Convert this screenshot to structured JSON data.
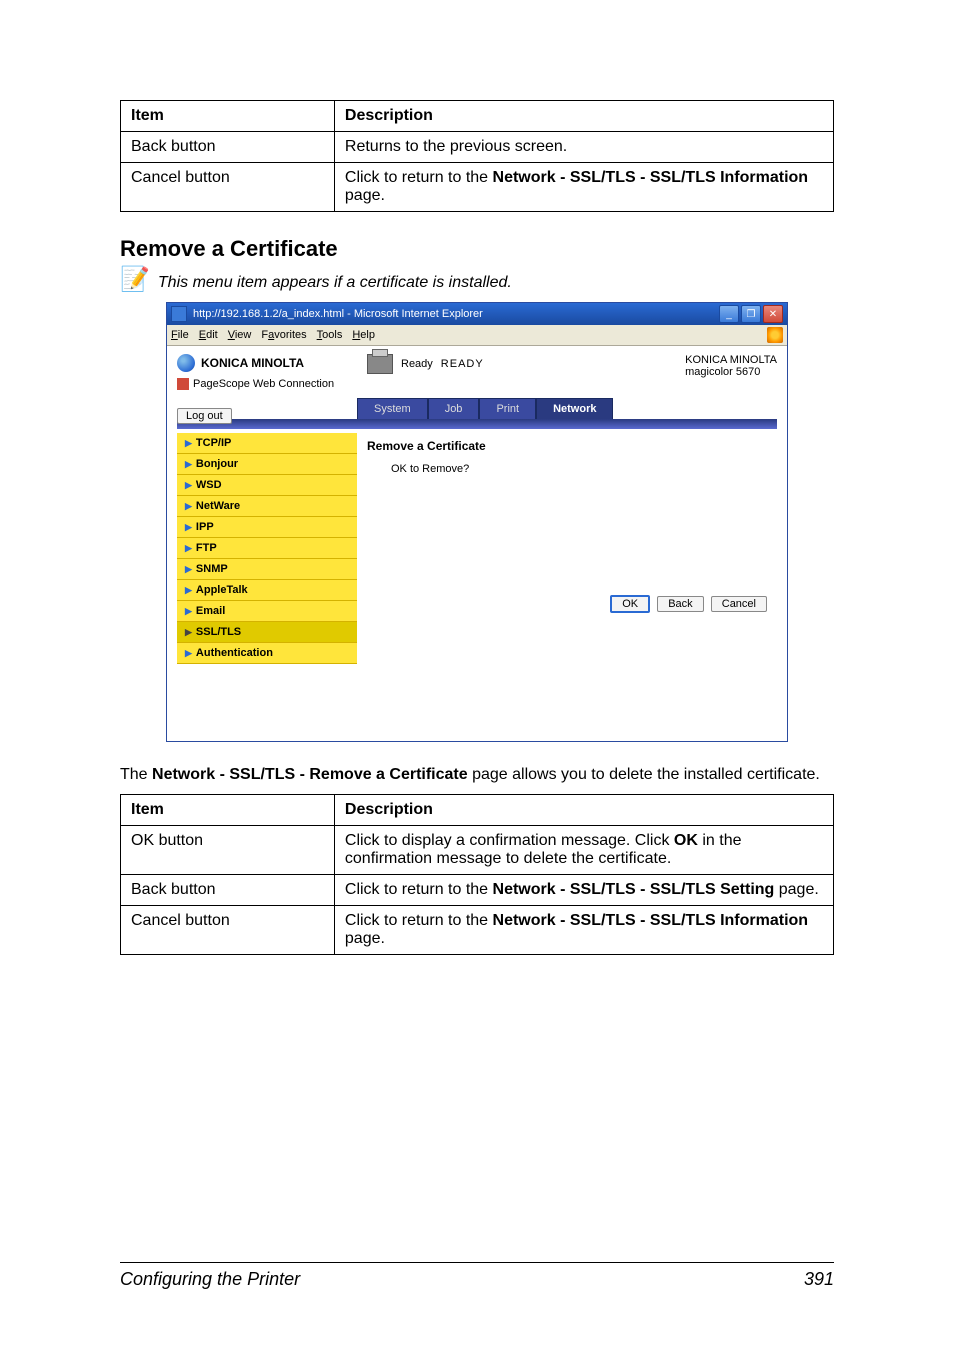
{
  "tables": {
    "top": {
      "headers": [
        "Item",
        "Description"
      ],
      "rows": [
        {
          "item": "Back button",
          "desc_plain": "Returns to the previous screen."
        },
        {
          "item": "Cancel button",
          "desc_pre": "Click to return to the ",
          "desc_bold": "Network - SSL/TLS - SSL/TLS Information",
          "desc_post": " page."
        }
      ]
    },
    "bottom": {
      "headers": [
        "Item",
        "Description"
      ],
      "rows": [
        {
          "item": "OK button",
          "desc_pre": "Click to display a confirmation message. Click ",
          "desc_bold": "OK",
          "desc_post": " in the confirmation message to delete the certificate."
        },
        {
          "item": "Back button",
          "desc_pre": "Click to return to the ",
          "desc_bold": "Network - SSL/TLS - SSL/TLS Setting",
          "desc_post": " page."
        },
        {
          "item": "Cancel button",
          "desc_pre": "Click to return to the ",
          "desc_bold": "Network - SSL/TLS - SSL/TLS Information",
          "desc_post": " page."
        }
      ]
    }
  },
  "section_heading": "Remove a Certificate",
  "note_text": "This menu item appears if a certificate is installed.",
  "paragraph": {
    "pre": "The ",
    "bold": "Network - SSL/TLS - Remove a Certificate",
    "post": " page allows you to delete the installed certificate."
  },
  "ie": {
    "title": "http://192.168.1.2/a_index.html - Microsoft Internet Explorer",
    "menus": [
      "File",
      "Edit",
      "View",
      "Favorites",
      "Tools",
      "Help"
    ],
    "brand": "KONICA MINOLTA",
    "pagescope": "PageScope Web Connection",
    "status_label": "Ready",
    "status_big": "READY",
    "right_brand": "KONICA MINOLTA",
    "right_model": "magicolor 5670",
    "logout": "Log out",
    "tabs": [
      "System",
      "Job",
      "Print",
      "Network"
    ],
    "active_tab_index": 3,
    "nav": [
      "TCP/IP",
      "Bonjour",
      "WSD",
      "NetWare",
      "IPP",
      "FTP",
      "SNMP",
      "AppleTalk",
      "Email",
      "SSL/TLS",
      "Authentication"
    ],
    "nav_selected_index": 9,
    "main_title": "Remove a Certificate",
    "main_msg": "OK to Remove?",
    "buttons": {
      "ok": "OK",
      "back": "Back",
      "cancel": "Cancel"
    },
    "win_min": "_",
    "win_max": "❐",
    "win_close": "✕"
  },
  "footer": {
    "title": "Configuring the Printer",
    "page": "391"
  }
}
